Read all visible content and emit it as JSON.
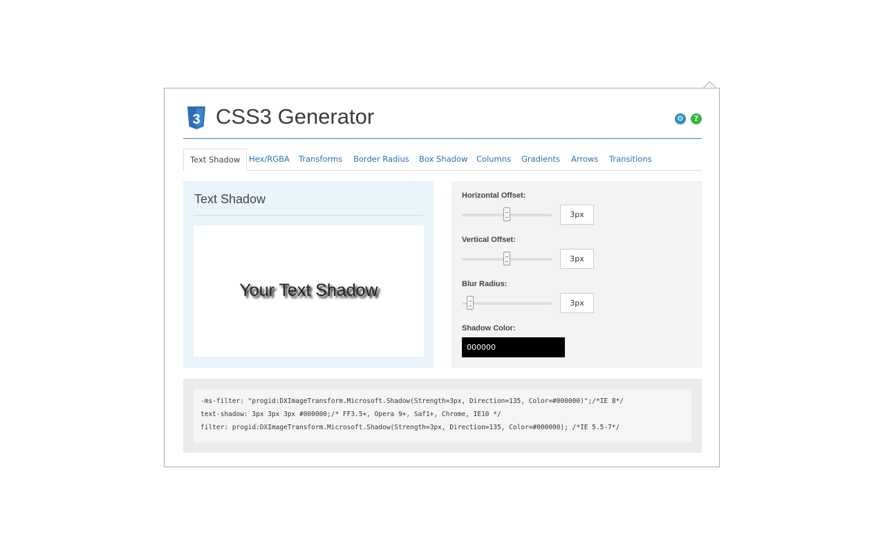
{
  "header": {
    "title": "CSS3 Generator",
    "logo_icon": "css3-shield-icon",
    "logo_number": "3",
    "settings_icon": "gear-icon",
    "help_icon": "question-icon",
    "help_glyph": "?",
    "settings_glyph": "⚙"
  },
  "tabs": [
    {
      "label": "Text Shadow",
      "active": true
    },
    {
      "label": "Hex/RGBA"
    },
    {
      "label": "Transforms"
    },
    {
      "label": "Border Radius"
    },
    {
      "label": "Box Shadow"
    },
    {
      "label": "Columns"
    },
    {
      "label": "Gradients"
    },
    {
      "label": "Arrows"
    },
    {
      "label": "Transitions"
    }
  ],
  "preview": {
    "title": "Text Shadow",
    "sample_text": "Your Text Shadow"
  },
  "controls": {
    "horizontal": {
      "label": "Horizontal Offset:",
      "value": "3px",
      "slider_fraction": 0.5
    },
    "vertical": {
      "label": "Vertical Offset:",
      "value": "3px",
      "slider_fraction": 0.5
    },
    "blur": {
      "label": "Blur Radius:",
      "value": "3px",
      "slider_fraction": 0.06
    },
    "color": {
      "label": "Shadow Color:",
      "value": "000000"
    }
  },
  "code": {
    "line1": "-ms-filter: \"progid:DXImageTransform.Microsoft.Shadow(Strength=3px, Direction=135, Color=#000000)\";/*IE 8*/",
    "line2": "text-shadow: 3px 3px 3px #000000;/* FF3.5+, Opera 9+, Saf1+, Chrome, IE10 */",
    "line3": "filter: progid:DXImageTransform.Microsoft.Shadow(Strength=3px, Direction=135, Color=#000000); /*IE 5.5-7*/"
  },
  "colors": {
    "accent": "#2a6fb8",
    "header_rule": "#3a7fb5",
    "preview_bg": "#e9f4fb",
    "controls_bg": "#f3f3f3",
    "logo_blue": "#2f6db5"
  }
}
